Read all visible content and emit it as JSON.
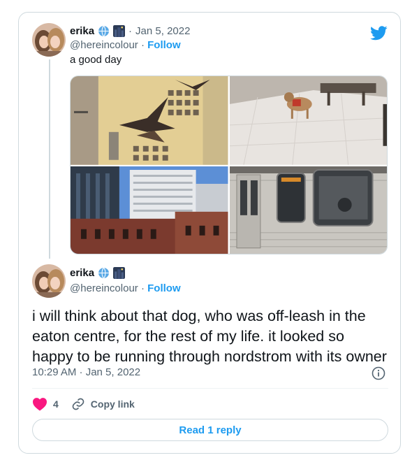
{
  "tweet1": {
    "name": "erika",
    "separator": "·",
    "date": "Jan 5, 2022",
    "handle": "@hereincolour",
    "follow_sep": "·",
    "follow_label": "Follow",
    "text": "a good day"
  },
  "tweet2": {
    "name": "erika",
    "handle": "@hereincolour",
    "follow_sep": "·",
    "follow_label": "Follow",
    "text": "i will think about that dog, who was off-leash in the eaton centre, for the rest of my life. it looked so happy to be running through nordstrom with its owner",
    "timestamp": "10:29 AM · Jan 5, 2022"
  },
  "actions": {
    "like_count": "4",
    "copy_link_label": "Copy link",
    "read_reply_label": "Read 1 reply"
  },
  "colors": {
    "accent": "#1d9bf0",
    "like": "#f91880",
    "text": "#0f1419",
    "muted": "#536471"
  },
  "icons": [
    "twitter-bird-icon",
    "globe-emoji-icon",
    "city-night-emoji-icon",
    "heart-icon",
    "link-icon",
    "info-icon"
  ]
}
